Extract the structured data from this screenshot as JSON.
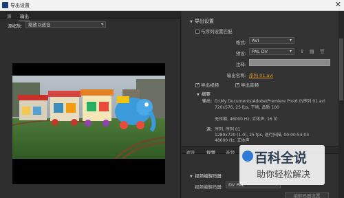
{
  "window": {
    "title": "导出设置",
    "close_glyph": "✕"
  },
  "left_tabs": {
    "source": "源",
    "output": "输出"
  },
  "scaling": {
    "label": "源缩放:",
    "value": "缩放以适合"
  },
  "export_settings": {
    "header": "导出设置",
    "match_sequence_label": "与序列设置匹配",
    "format_label": "格式:",
    "format_value": "AVI",
    "preset_label": "预设:",
    "preset_value": "PAL DV",
    "comments_label": "注释:",
    "comments_value": "",
    "output_name_label": "输出名称:",
    "output_name_value": "序列 01.avi",
    "export_video_label": "导出视频",
    "export_audio_label": "导出音频",
    "export_video_checked": true,
    "export_audio_checked": true
  },
  "summary": {
    "header": "摘要",
    "output_key": "输出:",
    "output_line1": "D:\\My Documents\\Adobe\\Premiere Pro\\6.0\\序列 01.avi",
    "output_line2": "720x576, 25 fps, 下场, 品质 100",
    "output_line3": "无压缩, 48000 Hz, 立体声, 16 位",
    "source_key": "源:",
    "source_line1": "序列, 序列 01",
    "source_line2": "1280x720 (1.0), 25 fps, 逐行扫描, 00:00:54:03",
    "source_line3": "48000 Hz, 立体声"
  },
  "bottom_tabs": [
    "滤镜",
    "视频",
    "音频"
  ],
  "codec": {
    "header": "视频编解码器",
    "codec_label": "视频编解码器:",
    "codec_value": "DV PAL",
    "settings_button": "编解码器设置"
  },
  "watermark": {
    "title": "百科全说",
    "subtitle": "助你轻松解决"
  },
  "colors": {
    "accent_link": "#e0a030",
    "panel": "#333333",
    "titlebar": "#f2f2f2"
  }
}
